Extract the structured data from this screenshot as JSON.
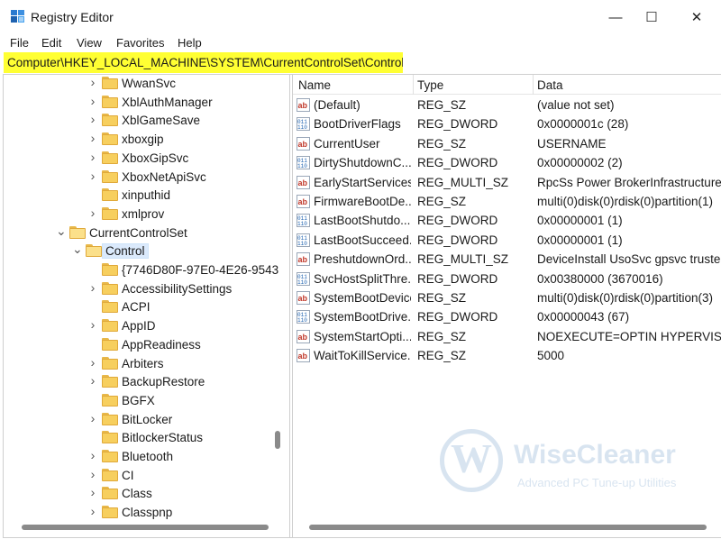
{
  "window": {
    "title": "Registry Editor",
    "minimize_glyph": "—",
    "maximize_glyph": "☐",
    "close_glyph": "✕"
  },
  "menu": {
    "items": [
      "File",
      "Edit",
      "View",
      "Favorites",
      "Help"
    ]
  },
  "address": {
    "path": "Computer\\HKEY_LOCAL_MACHINE\\SYSTEM\\CurrentControlSet\\Control",
    "highlight_color": "#ffff33"
  },
  "tree": {
    "items": [
      {
        "label": "WwanSvc",
        "level": 2,
        "expandable": true,
        "expanded": false
      },
      {
        "label": "XblAuthManager",
        "level": 2,
        "expandable": true,
        "expanded": false
      },
      {
        "label": "XblGameSave",
        "level": 2,
        "expandable": true,
        "expanded": false
      },
      {
        "label": "xboxgip",
        "level": 2,
        "expandable": true,
        "expanded": false
      },
      {
        "label": "XboxGipSvc",
        "level": 2,
        "expandable": true,
        "expanded": false
      },
      {
        "label": "XboxNetApiSvc",
        "level": 2,
        "expandable": true,
        "expanded": false
      },
      {
        "label": "xinputhid",
        "level": 2,
        "expandable": false,
        "expanded": false
      },
      {
        "label": "xmlprov",
        "level": 2,
        "expandable": true,
        "expanded": false
      },
      {
        "label": "CurrentControlSet",
        "level": 0,
        "expandable": true,
        "expanded": true
      },
      {
        "label": "Control",
        "level": 1,
        "expandable": true,
        "expanded": true,
        "selected": true
      },
      {
        "label": "{7746D80F-97E0-4E26-9543",
        "level": 2,
        "expandable": false,
        "expanded": false
      },
      {
        "label": "AccessibilitySettings",
        "level": 2,
        "expandable": true,
        "expanded": false
      },
      {
        "label": "ACPI",
        "level": 2,
        "expandable": false,
        "expanded": false
      },
      {
        "label": "AppID",
        "level": 2,
        "expandable": true,
        "expanded": false
      },
      {
        "label": "AppReadiness",
        "level": 2,
        "expandable": false,
        "expanded": false
      },
      {
        "label": "Arbiters",
        "level": 2,
        "expandable": true,
        "expanded": false
      },
      {
        "label": "BackupRestore",
        "level": 2,
        "expandable": true,
        "expanded": false
      },
      {
        "label": "BGFX",
        "level": 2,
        "expandable": false,
        "expanded": false
      },
      {
        "label": "BitLocker",
        "level": 2,
        "expandable": true,
        "expanded": false
      },
      {
        "label": "BitlockerStatus",
        "level": 2,
        "expandable": false,
        "expanded": false
      },
      {
        "label": "Bluetooth",
        "level": 2,
        "expandable": true,
        "expanded": false
      },
      {
        "label": "CI",
        "level": 2,
        "expandable": true,
        "expanded": false
      },
      {
        "label": "Class",
        "level": 2,
        "expandable": true,
        "expanded": false
      },
      {
        "label": "Classpnp",
        "level": 2,
        "expandable": true,
        "expanded": false
      }
    ]
  },
  "values_list": {
    "columns": [
      "Name",
      "Type",
      "Data"
    ],
    "rows": [
      {
        "name": "(Default)",
        "type": "REG_SZ",
        "data": "(value not set)",
        "icon": "string-value-icon"
      },
      {
        "name": "BootDriverFlags",
        "type": "REG_DWORD",
        "data": "0x0000001c (28)",
        "icon": "binary-value-icon"
      },
      {
        "name": "CurrentUser",
        "type": "REG_SZ",
        "data": "USERNAME",
        "icon": "string-value-icon"
      },
      {
        "name": "DirtyShutdownC...",
        "type": "REG_DWORD",
        "data": "0x00000002 (2)",
        "icon": "binary-value-icon"
      },
      {
        "name": "EarlyStartServices",
        "type": "REG_MULTI_SZ",
        "data": "RpcSs Power BrokerInfrastructure S",
        "icon": "string-value-icon"
      },
      {
        "name": "FirmwareBootDe...",
        "type": "REG_SZ",
        "data": "multi(0)disk(0)rdisk(0)partition(1)",
        "icon": "string-value-icon"
      },
      {
        "name": "LastBootShutdo...",
        "type": "REG_DWORD",
        "data": "0x00000001 (1)",
        "icon": "binary-value-icon"
      },
      {
        "name": "LastBootSucceed...",
        "type": "REG_DWORD",
        "data": "0x00000001 (1)",
        "icon": "binary-value-icon"
      },
      {
        "name": "PreshutdownOrd...",
        "type": "REG_MULTI_SZ",
        "data": "DeviceInstall UsoSvc gpsvc trusted",
        "icon": "string-value-icon"
      },
      {
        "name": "SvcHostSplitThre...",
        "type": "REG_DWORD",
        "data": "0x00380000 (3670016)",
        "icon": "binary-value-icon"
      },
      {
        "name": "SystemBootDevice",
        "type": "REG_SZ",
        "data": "multi(0)disk(0)rdisk(0)partition(3)",
        "icon": "string-value-icon"
      },
      {
        "name": "SystemBootDrive...",
        "type": "REG_DWORD",
        "data": "0x00000043 (67)",
        "icon": "binary-value-icon"
      },
      {
        "name": "SystemStartOpti...",
        "type": "REG_SZ",
        "data": " NOEXECUTE=OPTIN  HYPERVISO",
        "icon": "string-value-icon"
      },
      {
        "name": "WaitToKillService...",
        "type": "REG_SZ",
        "data": "5000",
        "icon": "string-value-icon"
      }
    ]
  },
  "watermark": {
    "brand": "WiseCleaner",
    "tagline": "Advanced PC Tune-up Utilities",
    "logo_letter": "W"
  }
}
